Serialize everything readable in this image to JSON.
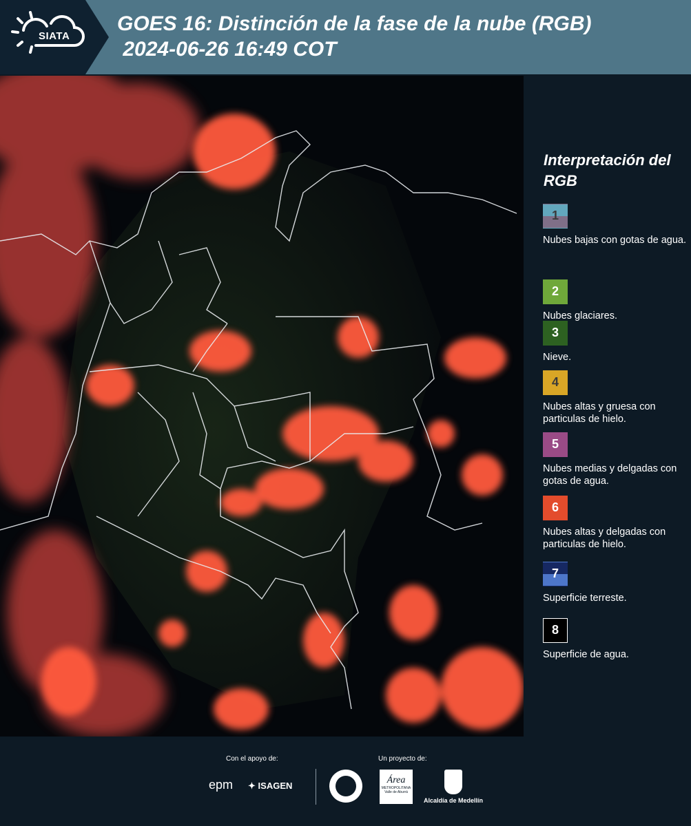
{
  "header": {
    "logo_text": "SIATA",
    "title": "GOES 16: Distinción de la fase de la nube (RGB)\n 2024-06-26 16:49 COT"
  },
  "legend": {
    "title": "Interpretación del RGB",
    "items": [
      {
        "number": "1",
        "label": "Nubes bajas con gotas de agua.",
        "color_top": "#62a7bd",
        "color_bottom": "#7f6f88"
      },
      {
        "number": "2",
        "label": "Nubes glaciares.",
        "color_top": "#6fa83a",
        "color_bottom": "#6fa83a"
      },
      {
        "number": "3",
        "label": "Nieve.",
        "color_top": "#2d6121",
        "color_bottom": "#2d6121"
      },
      {
        "number": "4",
        "label": "Nubes altas y gruesa con particulas de hielo.",
        "color_top": "#d9a626",
        "color_bottom": "#d9a626"
      },
      {
        "number": "5",
        "label": "Nubes medias y delgadas con gotas de agua.",
        "color_top": "#9a4b86",
        "color_bottom": "#9a4b86"
      },
      {
        "number": "6",
        "label": "Nubes altas y delgadas con particulas de hielo.",
        "color_top": "#e34c2c",
        "color_bottom": "#e34c2c"
      },
      {
        "number": "7",
        "label": "Superficie terreste.",
        "color_top": "#162862",
        "color_bottom": "#4d76c9"
      },
      {
        "number": "8",
        "label": "Superficie de agua.",
        "color_top": "#000000",
        "color_bottom": "#000000"
      }
    ]
  },
  "footer": {
    "support_label": "Con el apoyo de:",
    "project_label": "Un proyecto de:",
    "epm": "epm",
    "isagen": "ISAGEN",
    "area_text": "Área",
    "area_sub": "METROPOLITANA",
    "area_sub2": "Valle de Aburrá",
    "alcaldia": "Alcaldía de Medellín"
  }
}
